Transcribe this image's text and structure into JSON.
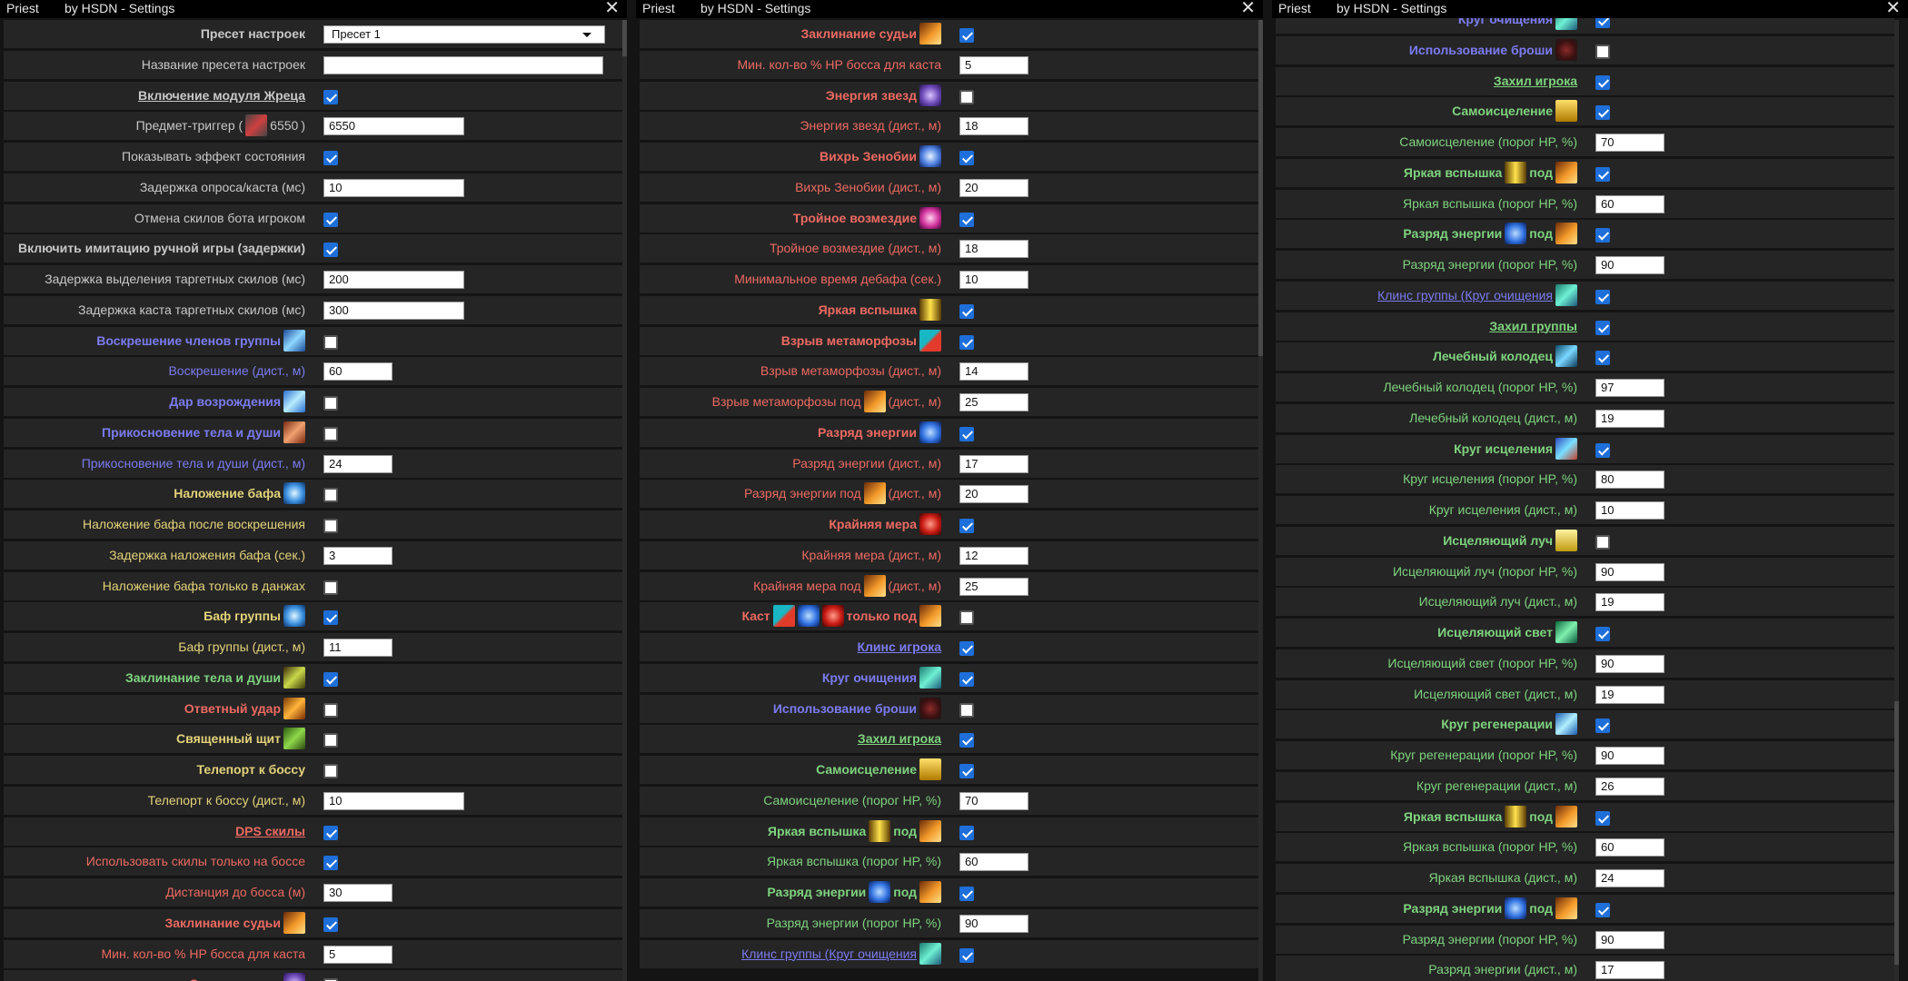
{
  "window": {
    "title": "Priest",
    "subtitle": "by HSDN - Settings",
    "close": "✕"
  },
  "icons": {
    "judgement": "orange-swirl-icon",
    "stars": "purple-star-icon",
    "zenobia": "blue-vortex-icon",
    "retribution": "magenta-burst-icon",
    "flash": "golden-flash-icon",
    "meta": "teal-red-explosion-icon",
    "energy": "blue-energy-icon",
    "extreme": "red-splash-icon",
    "purify": "teal-circle-icon",
    "brooch": "brooch-icon",
    "heal-self": "yellow-figure-icon",
    "revive": "blue-revive-icon",
    "gift": "blue-wings-icon",
    "touch": "red-fist-icon",
    "buff": "blue-snowflake-icon",
    "body-spell": "green-dagger-icon",
    "counter": "fiery-fist-icon",
    "shield": "green-shield-icon",
    "well": "teal-well-icon",
    "heal-circle": "blue-heal-circle-icon",
    "ray": "yellow-ray-icon",
    "light": "green-light-icon",
    "regen": "blue-regen-icon",
    "item": "red-crystal-icon"
  },
  "panel1": {
    "rows": [
      {
        "label": "Пресет настроек",
        "c": "gr",
        "b": 1,
        "ctrl": "select",
        "val": "Пресет 1"
      },
      {
        "label": "Название пресета настроек",
        "c": "gr",
        "ctrl": "text3",
        "val": ""
      },
      {
        "label": "Включение модуля Жреца",
        "c": "gr",
        "b": 1,
        "u": 1,
        "ctrl": "cb",
        "on": 1
      },
      {
        "parts": [
          "Предмет-триггер (",
          "#item",
          "6550",
          ")"
        ],
        "c": "gr",
        "ctrl": "text2",
        "val": "6550"
      },
      {
        "label": "Показывать эффект состояния",
        "c": "gr",
        "ctrl": "cb",
        "on": 1
      },
      {
        "label": "Задержка опроса/каста (мс)",
        "c": "gr",
        "ctrl": "text2",
        "val": "10"
      },
      {
        "label": "Отмена скилов бота игроком",
        "c": "gr",
        "ctrl": "cb",
        "on": 1
      },
      {
        "label": "Включить имитацию ручной игры (задержки)",
        "c": "gr",
        "b": 1,
        "ctrl": "cb",
        "on": 1
      },
      {
        "label": "Задержка выделения таргетных скилов (мс)",
        "c": "gr",
        "ctrl": "text2",
        "val": "200"
      },
      {
        "label": "Задержка каста таргетных скилов (мс)",
        "c": "gr",
        "ctrl": "text2",
        "val": "300"
      },
      {
        "parts": [
          "Воскрешение членов группы",
          "#revive"
        ],
        "c": "bl",
        "b": 1,
        "ctrl": "cb",
        "on": 0
      },
      {
        "label": "Воскрешение (дист., м)",
        "c": "bl",
        "ctrl": "text",
        "val": "60"
      },
      {
        "parts": [
          "Дар возрождения",
          "#gift"
        ],
        "c": "bl",
        "b": 1,
        "ctrl": "cb",
        "on": 0
      },
      {
        "parts": [
          "Прикосновение тела и души",
          "#touch"
        ],
        "c": "bl",
        "b": 1,
        "ctrl": "cb",
        "on": 0
      },
      {
        "label": "Прикосновение тела и души (дист., м)",
        "c": "bl",
        "ctrl": "text",
        "val": "24"
      },
      {
        "parts": [
          "Наложение бафа",
          "#buff"
        ],
        "c": "ye",
        "b": 1,
        "ctrl": "cb",
        "on": 0
      },
      {
        "label": "Наложение бафа после воскрешения",
        "c": "ye",
        "ctrl": "cb",
        "on": 0
      },
      {
        "label": "Задержка наложения бафа (сек.)",
        "c": "ye",
        "ctrl": "text",
        "val": "3"
      },
      {
        "label": "Наложение бафа только в данжах",
        "c": "ye",
        "ctrl": "cb",
        "on": 0
      },
      {
        "parts": [
          "Баф группы",
          "#buff"
        ],
        "c": "ye",
        "b": 1,
        "ctrl": "cb",
        "on": 1
      },
      {
        "label": "Баф группы (дист., м)",
        "c": "ye",
        "ctrl": "text",
        "val": "11"
      },
      {
        "parts": [
          "Заклинание тела и души",
          "#body-spell"
        ],
        "c": "gn",
        "b": 1,
        "ctrl": "cb",
        "on": 1
      },
      {
        "parts": [
          "Ответный удар",
          "#counter"
        ],
        "c": "rd",
        "b": 1,
        "ctrl": "cb",
        "on": 0
      },
      {
        "parts": [
          "Священный щит",
          "#shield"
        ],
        "c": "ye",
        "b": 1,
        "ctrl": "cb",
        "on": 0
      },
      {
        "label": "Телепорт к боссу",
        "c": "ye",
        "b": 1,
        "ctrl": "cb",
        "on": 0
      },
      {
        "label": "Телепорт к боссу (дист., м)",
        "c": "ye",
        "ctrl": "text2",
        "val": "10"
      },
      {
        "label": "DPS скилы",
        "c": "rd",
        "b": 1,
        "u": 1,
        "ctrl": "cb",
        "on": 1
      },
      {
        "label": "Использовать скилы только на боссе",
        "c": "rd",
        "ctrl": "cb",
        "on": 1
      },
      {
        "label": "Дистанция до босса (м)",
        "c": "rd",
        "ctrl": "text",
        "val": "30"
      },
      {
        "parts": [
          "Заклинание судьи",
          "#judgement"
        ],
        "c": "rd",
        "b": 1,
        "ctrl": "cb",
        "on": 1
      },
      {
        "label": "Мин. кол-во % HP босса для каста",
        "c": "rd",
        "ctrl": "text",
        "val": "5"
      },
      {
        "parts": [
          "Энергия звезд",
          "#stars"
        ],
        "c": "rd",
        "b": 1,
        "ctrl": "cb",
        "on": 0
      }
    ]
  },
  "panel2": {
    "rows": [
      {
        "parts": [
          "Заклинание судьи",
          "#judgement"
        ],
        "c": "rd",
        "b": 1,
        "ctrl": "cb",
        "on": 1
      },
      {
        "label": "Мин. кол-во % HP босса для каста",
        "c": "rd",
        "ctrl": "text",
        "val": "5"
      },
      {
        "parts": [
          "Энергия звезд",
          "#stars"
        ],
        "c": "rd",
        "b": 1,
        "ctrl": "cb",
        "on": 0
      },
      {
        "label": "Энергия звезд (дист., м)",
        "c": "rd",
        "ctrl": "text",
        "val": "18"
      },
      {
        "parts": [
          "Вихрь Зенобии",
          "#zenobia"
        ],
        "c": "rd",
        "b": 1,
        "ctrl": "cb",
        "on": 1
      },
      {
        "label": "Вихрь Зенобии (дист., м)",
        "c": "rd",
        "ctrl": "text",
        "val": "20"
      },
      {
        "parts": [
          "Тройное возмездие",
          "#retribution"
        ],
        "c": "rd",
        "b": 1,
        "ctrl": "cb",
        "on": 1
      },
      {
        "label": "Тройное возмездие (дист., м)",
        "c": "rd",
        "ctrl": "text",
        "val": "18"
      },
      {
        "label": "Минимальное время дебафа (сек.)",
        "c": "rd",
        "ctrl": "text",
        "val": "10"
      },
      {
        "parts": [
          "Яркая вспышка",
          "#flash"
        ],
        "c": "rd",
        "b": 1,
        "ctrl": "cb",
        "on": 1
      },
      {
        "parts": [
          "Взрыв метаморфозы",
          "#meta"
        ],
        "c": "rd",
        "b": 1,
        "ctrl": "cb",
        "on": 1
      },
      {
        "label": "Взрыв метаморфозы (дист., м)",
        "c": "rd",
        "ctrl": "text",
        "val": "14"
      },
      {
        "parts": [
          "Взрыв метаморфозы под",
          "#judgement",
          "(дист., м)"
        ],
        "c": "rd",
        "ctrl": "text",
        "val": "25"
      },
      {
        "parts": [
          "Разряд энергии",
          "#energy"
        ],
        "c": "rd",
        "b": 1,
        "ctrl": "cb",
        "on": 1
      },
      {
        "label": "Разряд энергии (дист., м)",
        "c": "rd",
        "ctrl": "text",
        "val": "17"
      },
      {
        "parts": [
          "Разряд энергии под",
          "#judgement",
          "(дист., м)"
        ],
        "c": "rd",
        "ctrl": "text",
        "val": "20"
      },
      {
        "parts": [
          "Крайняя мера",
          "#extreme"
        ],
        "c": "rd",
        "b": 1,
        "ctrl": "cb",
        "on": 1
      },
      {
        "label": "Крайняя мера (дист., м)",
        "c": "rd",
        "ctrl": "text",
        "val": "12"
      },
      {
        "parts": [
          "Крайняя мера под",
          "#judgement",
          "(дист., м)"
        ],
        "c": "rd",
        "ctrl": "text",
        "val": "25"
      },
      {
        "parts": [
          "Каст",
          "#meta",
          "#energy",
          "#extreme",
          "только под",
          "#judgement"
        ],
        "c": "rd",
        "b": 1,
        "ctrl": "cb",
        "on": 0
      },
      {
        "label": "Клинс игрока",
        "c": "bl",
        "b": 1,
        "u": 1,
        "ctrl": "cb",
        "on": 1
      },
      {
        "parts": [
          "Круг очищения",
          "#purify"
        ],
        "c": "bl",
        "b": 1,
        "ctrl": "cb",
        "on": 1
      },
      {
        "parts": [
          "Использование броши",
          "#brooch"
        ],
        "c": "bl",
        "b": 1,
        "ctrl": "cb",
        "on": 0
      },
      {
        "label": "Захил игрока",
        "c": "gn",
        "b": 1,
        "u": 1,
        "ctrl": "cb",
        "on": 1
      },
      {
        "parts": [
          "Самоисцеление",
          "#heal-self"
        ],
        "c": "gn",
        "b": 1,
        "ctrl": "cb",
        "on": 1
      },
      {
        "label": "Самоисцеление (порог HP, %)",
        "c": "gn",
        "ctrl": "text",
        "val": "70"
      },
      {
        "parts": [
          "Яркая вспышка",
          "#flash",
          "под",
          "#judgement"
        ],
        "c": "gn",
        "b": 1,
        "ctrl": "cb",
        "on": 1
      },
      {
        "label": "Яркая вспышка (порог HP, %)",
        "c": "gn",
        "ctrl": "text",
        "val": "60"
      },
      {
        "parts": [
          "Разряд энергии",
          "#energy",
          "под",
          "#judgement"
        ],
        "c": "gn",
        "b": 1,
        "ctrl": "cb",
        "on": 1
      },
      {
        "label": "Разряд энергии (порог HP, %)",
        "c": "gn",
        "ctrl": "text",
        "val": "90"
      },
      {
        "parts": [
          "Клинс группы (Круг очищения",
          "#purify"
        ],
        "c": "bl",
        "u": 1,
        "ctrl": "cb",
        "on": 1
      }
    ]
  },
  "panel3": {
    "rows": [
      {
        "parts": [
          "Круг очищения",
          "#purify"
        ],
        "c": "bl",
        "b": 1,
        "ctrl": "cb",
        "on": 1
      },
      {
        "parts": [
          "Использование броши",
          "#brooch"
        ],
        "c": "bl",
        "b": 1,
        "ctrl": "cb",
        "on": 0
      },
      {
        "label": "Захил игрока",
        "c": "gn",
        "b": 1,
        "u": 1,
        "ctrl": "cb",
        "on": 1
      },
      {
        "parts": [
          "Самоисцеление",
          "#heal-self"
        ],
        "c": "gn",
        "b": 1,
        "ctrl": "cb",
        "on": 1
      },
      {
        "label": "Самоисцеление (порог HP, %)",
        "c": "gn",
        "ctrl": "text",
        "val": "70"
      },
      {
        "parts": [
          "Яркая вспышка",
          "#flash",
          "под",
          "#judgement"
        ],
        "c": "gn",
        "b": 1,
        "ctrl": "cb",
        "on": 1
      },
      {
        "label": "Яркая вспышка (порог HP, %)",
        "c": "gn",
        "ctrl": "text",
        "val": "60"
      },
      {
        "parts": [
          "Разряд энергии",
          "#energy",
          "под",
          "#judgement"
        ],
        "c": "gn",
        "b": 1,
        "ctrl": "cb",
        "on": 1
      },
      {
        "label": "Разряд энергии (порог HP, %)",
        "c": "gn",
        "ctrl": "text",
        "val": "90"
      },
      {
        "parts": [
          "Клинс группы (Круг очищения",
          "#purify"
        ],
        "c": "bl",
        "u": 1,
        "ctrl": "cb",
        "on": 1
      },
      {
        "label": "Захил группы",
        "c": "gn",
        "b": 1,
        "u": 1,
        "ctrl": "cb",
        "on": 1
      },
      {
        "parts": [
          "Лечебный колодец",
          "#well"
        ],
        "c": "gn",
        "b": 1,
        "ctrl": "cb",
        "on": 1
      },
      {
        "label": "Лечебный колодец (порог HP, %)",
        "c": "gn",
        "ctrl": "text",
        "val": "97"
      },
      {
        "label": "Лечебный колодец (дист., м)",
        "c": "gn",
        "ctrl": "text",
        "val": "19"
      },
      {
        "parts": [
          "Круг исцеления",
          "#heal-circle"
        ],
        "c": "gn",
        "b": 1,
        "ctrl": "cb",
        "on": 1
      },
      {
        "label": "Круг исцеления (порог HP, %)",
        "c": "gn",
        "ctrl": "text",
        "val": "80"
      },
      {
        "label": "Круг исцеления (дист., м)",
        "c": "gn",
        "ctrl": "text",
        "val": "10"
      },
      {
        "parts": [
          "Исцеляющий луч",
          "#ray"
        ],
        "c": "gn",
        "b": 1,
        "ctrl": "cb",
        "on": 0
      },
      {
        "label": "Исцеляющий луч (порог HP, %)",
        "c": "gn",
        "ctrl": "text",
        "val": "90"
      },
      {
        "label": "Исцеляющий луч (дист., м)",
        "c": "gn",
        "ctrl": "text",
        "val": "19"
      },
      {
        "parts": [
          "Исцеляющий свет",
          "#light"
        ],
        "c": "gn",
        "b": 1,
        "ctrl": "cb",
        "on": 1
      },
      {
        "label": "Исцеляющий свет (порог HP, %)",
        "c": "gn",
        "ctrl": "text",
        "val": "90"
      },
      {
        "label": "Исцеляющий свет (дист., м)",
        "c": "gn",
        "ctrl": "text",
        "val": "19"
      },
      {
        "parts": [
          "Круг регенерации",
          "#regen"
        ],
        "c": "gn",
        "b": 1,
        "ctrl": "cb",
        "on": 1
      },
      {
        "label": "Круг регенерации (порог HP, %)",
        "c": "gn",
        "ctrl": "text",
        "val": "90"
      },
      {
        "label": "Круг регенерации (дист., м)",
        "c": "gn",
        "ctrl": "text",
        "val": "26"
      },
      {
        "parts": [
          "Яркая вспышка",
          "#flash",
          "под",
          "#judgement"
        ],
        "c": "gn",
        "b": 1,
        "ctrl": "cb",
        "on": 1
      },
      {
        "label": "Яркая вспышка (порог HP, %)",
        "c": "gn",
        "ctrl": "text",
        "val": "60"
      },
      {
        "label": "Яркая вспышка (дист., м)",
        "c": "gn",
        "ctrl": "text",
        "val": "24"
      },
      {
        "parts": [
          "Разряд энергии",
          "#energy",
          "под",
          "#judgement"
        ],
        "c": "gn",
        "b": 1,
        "ctrl": "cb",
        "on": 1
      },
      {
        "label": "Разряд энергии (порог HP, %)",
        "c": "gn",
        "ctrl": "text",
        "val": "90"
      },
      {
        "label": "Разряд энергии (дист., м)",
        "c": "gn",
        "ctrl": "text",
        "val": "17"
      }
    ]
  }
}
